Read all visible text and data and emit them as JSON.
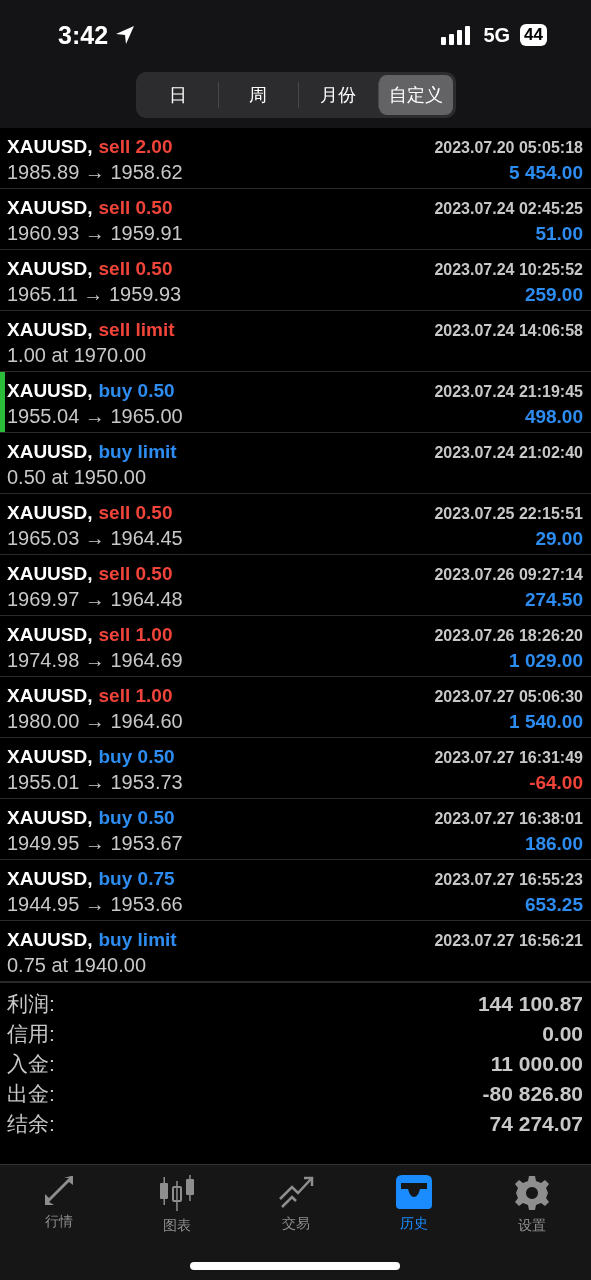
{
  "status_bar": {
    "time": "3:42",
    "network": "5G",
    "battery": "44"
  },
  "tabs": [
    {
      "label": "日",
      "selected": false
    },
    {
      "label": "周",
      "selected": false
    },
    {
      "label": "月份",
      "selected": false
    },
    {
      "label": "自定义",
      "selected": true
    }
  ],
  "orders": [
    {
      "symbol": "XAUUSD,",
      "kind": "sell",
      "order": "sell 2.00",
      "time": "2023.07.20 05:05:18",
      "prices": "1985.89 → 1958.62",
      "profit": "5 454.00",
      "loss": false,
      "selected": false
    },
    {
      "symbol": "XAUUSD,",
      "kind": "sell",
      "order": "sell 0.50",
      "time": "2023.07.24 02:45:25",
      "prices": "1960.93 → 1959.91",
      "profit": "51.00",
      "loss": false,
      "selected": false
    },
    {
      "symbol": "XAUUSD,",
      "kind": "sell",
      "order": "sell 0.50",
      "time": "2023.07.24 10:25:52",
      "prices": "1965.11 → 1959.93",
      "profit": "259.00",
      "loss": false,
      "selected": false
    },
    {
      "symbol": "XAUUSD,",
      "kind": "sell",
      "order": "sell limit",
      "time": "2023.07.24 14:06:58",
      "prices": "1.00 at 1970.00",
      "selected": false
    },
    {
      "symbol": "XAUUSD,",
      "kind": "buy",
      "order": "buy 0.50",
      "time": "2023.07.24 21:19:45",
      "prices": "1955.04 → 1965.00",
      "profit": "498.00",
      "loss": false,
      "selected": true
    },
    {
      "symbol": "XAUUSD,",
      "kind": "buy",
      "order": "buy limit",
      "time": "2023.07.24 21:02:40",
      "prices": "0.50 at 1950.00",
      "selected": false
    },
    {
      "symbol": "XAUUSD,",
      "kind": "sell",
      "order": "sell 0.50",
      "time": "2023.07.25 22:15:51",
      "prices": "1965.03 → 1964.45",
      "profit": "29.00",
      "loss": false,
      "selected": false
    },
    {
      "symbol": "XAUUSD,",
      "kind": "sell",
      "order": "sell 0.50",
      "time": "2023.07.26 09:27:14",
      "prices": "1969.97 → 1964.48",
      "profit": "274.50",
      "loss": false,
      "selected": false
    },
    {
      "symbol": "XAUUSD,",
      "kind": "sell",
      "order": "sell 1.00",
      "time": "2023.07.26 18:26:20",
      "prices": "1974.98 → 1964.69",
      "profit": "1 029.00",
      "loss": false,
      "selected": false
    },
    {
      "symbol": "XAUUSD,",
      "kind": "sell",
      "order": "sell 1.00",
      "time": "2023.07.27 05:06:30",
      "prices": "1980.00 → 1964.60",
      "profit": "1 540.00",
      "loss": false,
      "selected": false
    },
    {
      "symbol": "XAUUSD,",
      "kind": "buy",
      "order": "buy 0.50",
      "time": "2023.07.27 16:31:49",
      "prices": "1955.01 → 1953.73",
      "profit": "-64.00",
      "loss": true,
      "selected": false
    },
    {
      "symbol": "XAUUSD,",
      "kind": "buy",
      "order": "buy 0.50",
      "time": "2023.07.27 16:38:01",
      "prices": "1949.95 → 1953.67",
      "profit": "186.00",
      "loss": false,
      "selected": false
    },
    {
      "symbol": "XAUUSD,",
      "kind": "buy",
      "order": "buy 0.75",
      "time": "2023.07.27 16:55:23",
      "prices": "1944.95 → 1953.66",
      "profit": "653.25",
      "loss": false,
      "selected": false
    },
    {
      "symbol": "XAUUSD,",
      "kind": "buy",
      "order": "buy limit",
      "time": "2023.07.27 16:56:21",
      "prices": "0.75 at 1940.00",
      "selected": false
    }
  ],
  "summary": [
    {
      "label": "利润:",
      "value": "144 100.87"
    },
    {
      "label": "信用:",
      "value": "0.00"
    },
    {
      "label": "入金:",
      "value": "11 000.00"
    },
    {
      "label": "出金:",
      "value": "-80 826.80"
    },
    {
      "label": "结余:",
      "value": "74 274.07"
    }
  ],
  "nav": [
    {
      "kind": "quotes",
      "label": "行情",
      "selected": false
    },
    {
      "kind": "chart",
      "label": "图表",
      "selected": false
    },
    {
      "kind": "trade",
      "label": "交易",
      "selected": false
    },
    {
      "kind": "history",
      "label": "历史",
      "selected": true
    },
    {
      "kind": "settings",
      "label": "设置",
      "selected": false
    }
  ]
}
